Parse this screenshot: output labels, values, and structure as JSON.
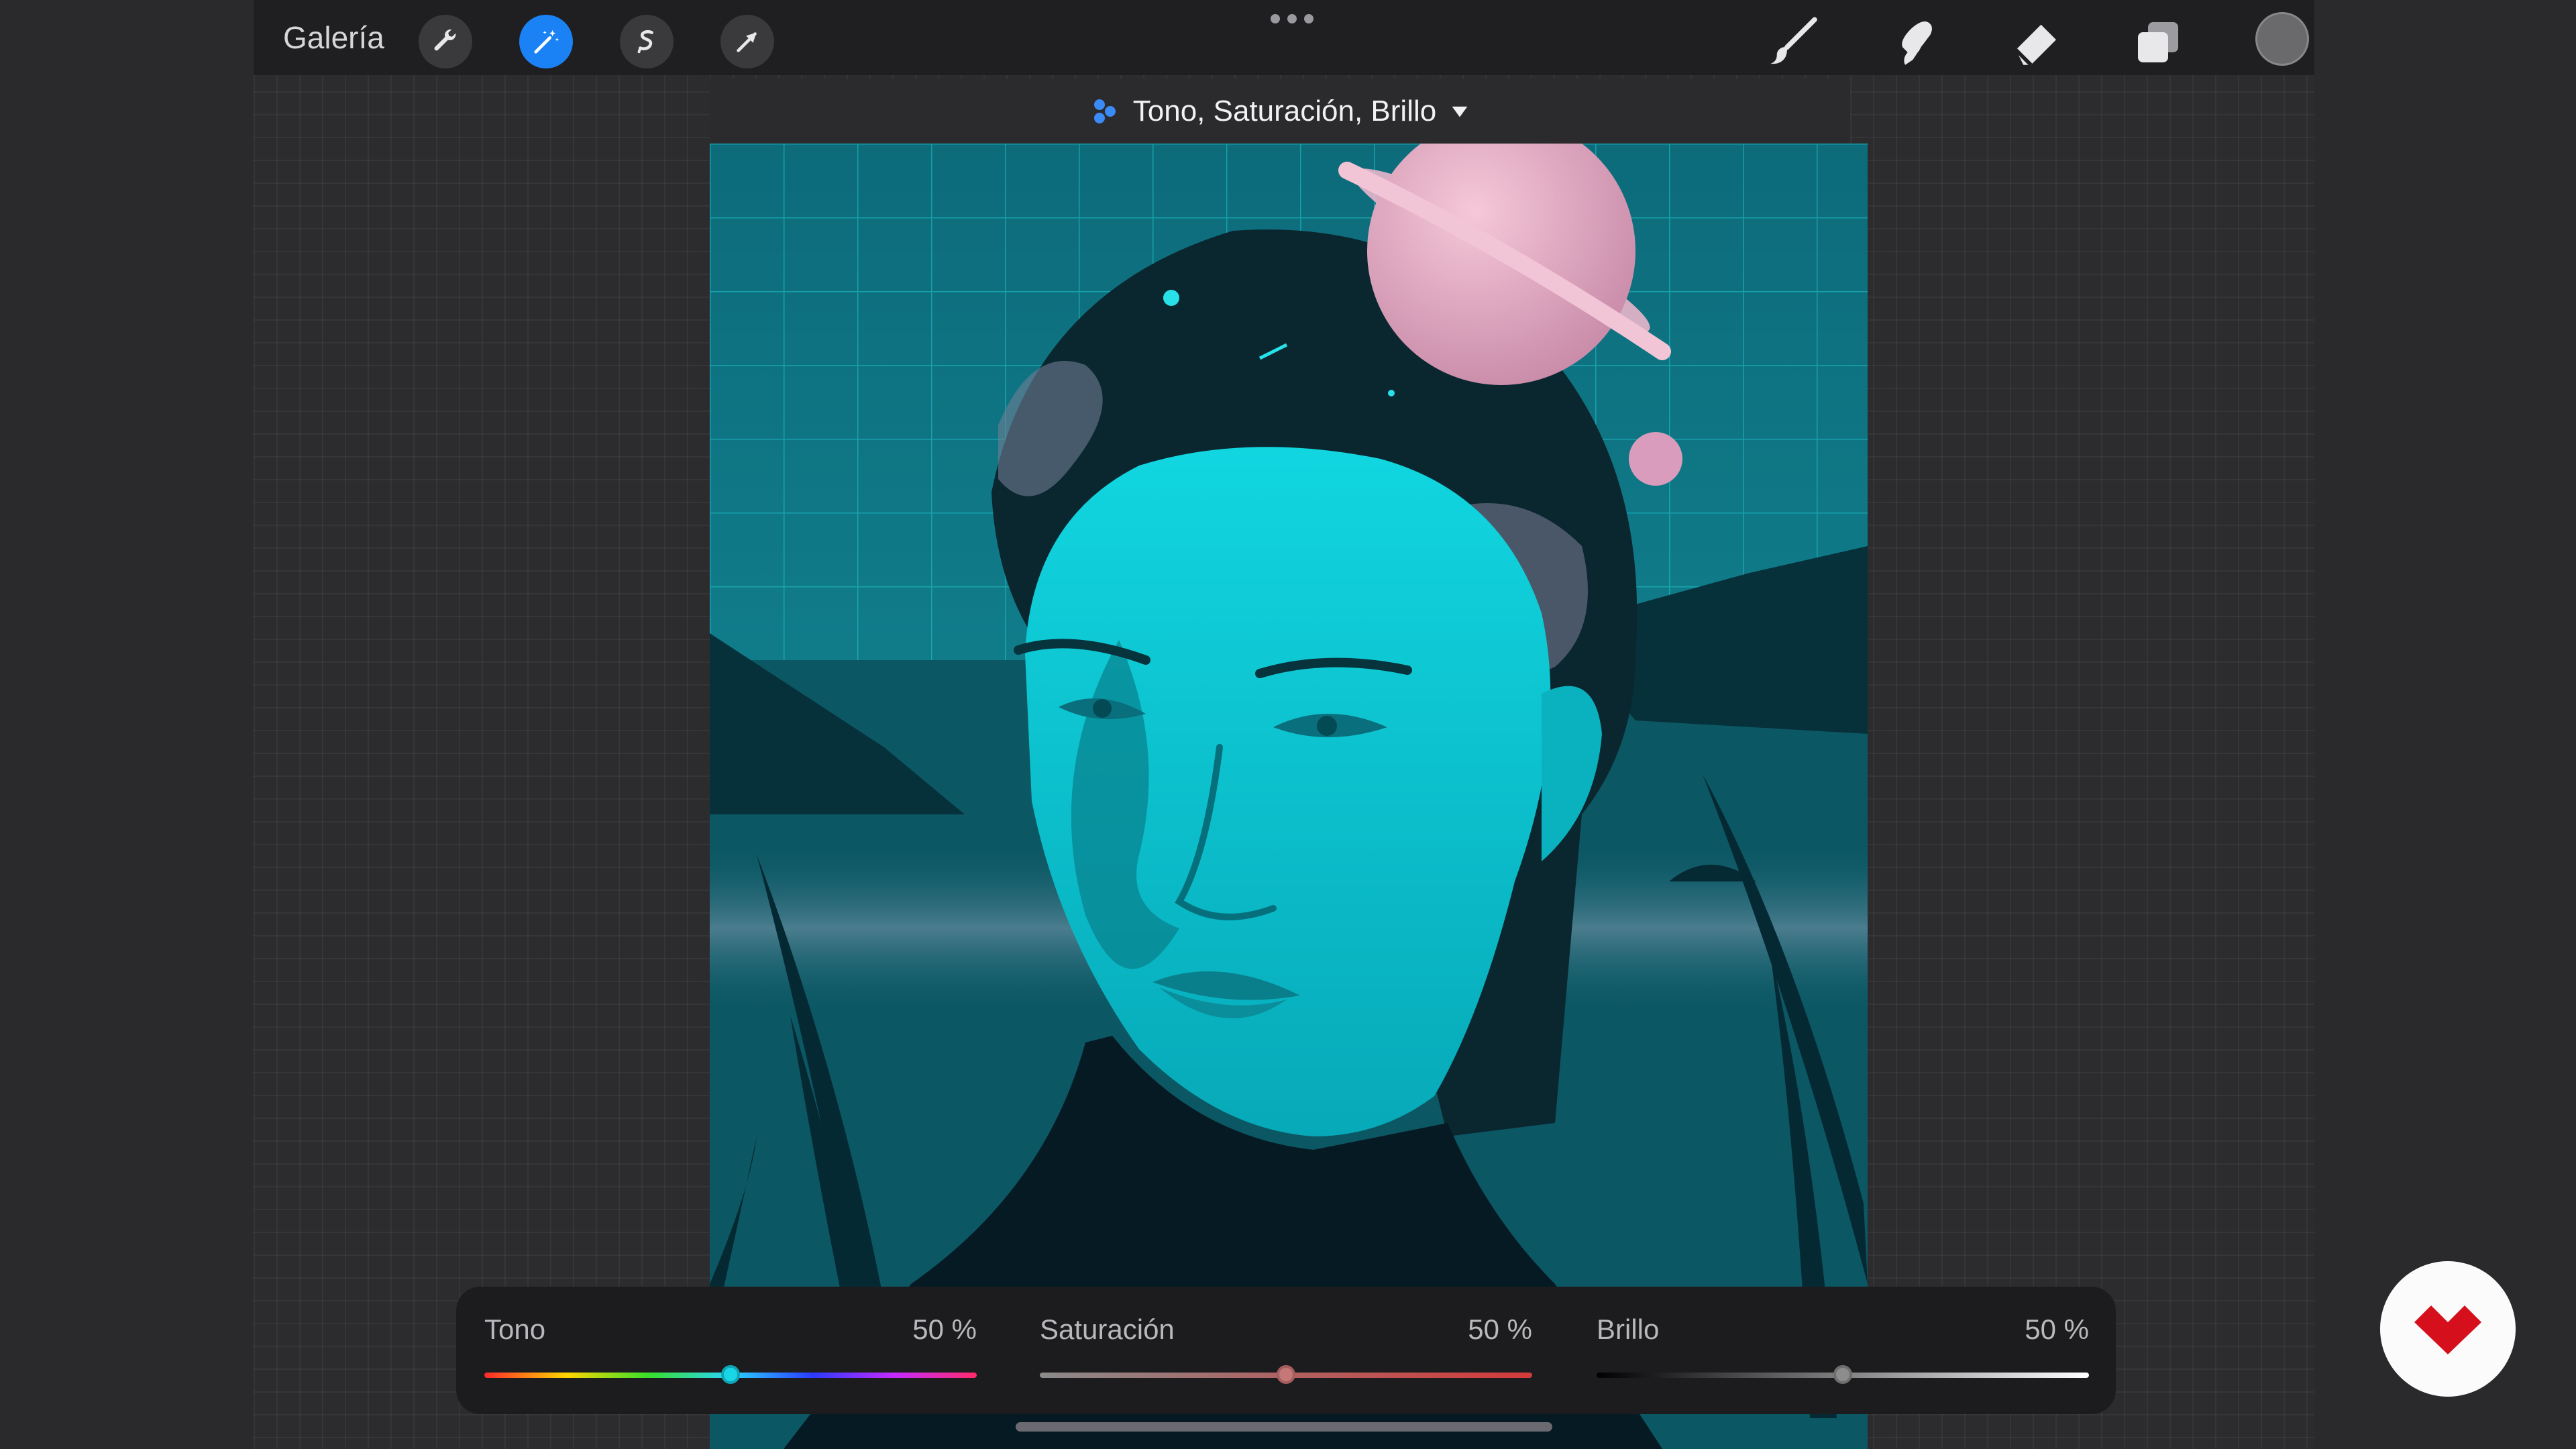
{
  "topbar": {
    "gallery_label": "Galería",
    "left_tools": [
      {
        "icon": "wrench-icon",
        "name": "actions-button"
      },
      {
        "icon": "magic-wand-icon",
        "name": "adjustments-button"
      },
      {
        "icon": "selection-icon",
        "name": "selection-button"
      },
      {
        "icon": "transform-arrow-icon",
        "name": "transform-button"
      }
    ],
    "right_tools": [
      {
        "icon": "brush-icon",
        "name": "brush-button"
      },
      {
        "icon": "smudge-icon",
        "name": "smudge-button"
      },
      {
        "icon": "eraser-icon",
        "name": "eraser-button"
      },
      {
        "icon": "layers-icon",
        "name": "layers-button"
      }
    ],
    "active_tool": "adjustments-button",
    "accent_color": "#1a82f4",
    "swatch_color": "#6a6a6c"
  },
  "adjustment": {
    "title": "Tono, Saturación, Brillo",
    "icon": "hsb-icon"
  },
  "sliders": [
    {
      "label": "Tono",
      "value_text": "50 %",
      "value": 0.5
    },
    {
      "label": "Saturación",
      "value_text": "50 %",
      "value": 0.5
    },
    {
      "label": "Brillo",
      "value_text": "50 %",
      "value": 0.5
    }
  ],
  "canvas": {
    "description_icon": "artwork-canvas"
  }
}
